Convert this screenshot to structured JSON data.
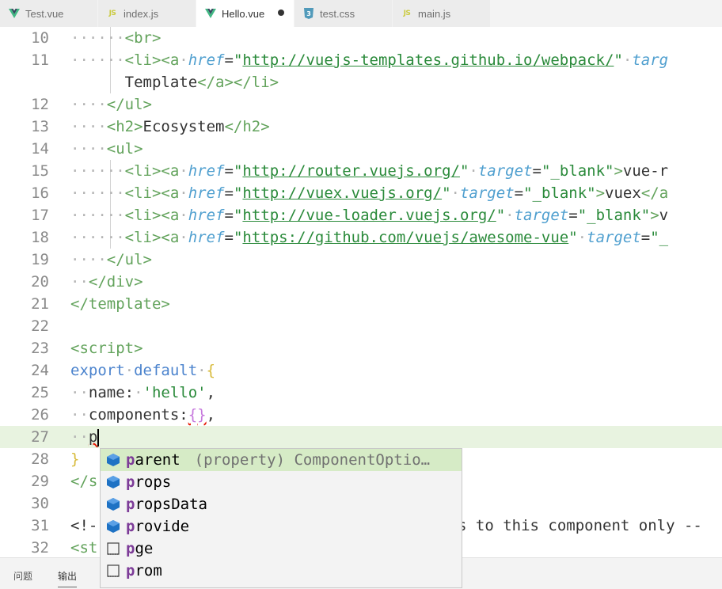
{
  "tabs": [
    {
      "label": "Test.vue",
      "icon": "vue-icon",
      "active": false,
      "dirty": false
    },
    {
      "label": "index.js",
      "icon": "js-icon",
      "active": false,
      "dirty": false
    },
    {
      "label": "Hello.vue",
      "icon": "vue-icon",
      "active": true,
      "dirty": true
    },
    {
      "label": "test.css",
      "icon": "css-icon",
      "active": false,
      "dirty": false
    },
    {
      "label": "main.js",
      "icon": "js-icon",
      "active": false,
      "dirty": false
    }
  ],
  "js_icon_text": "JS",
  "editor": {
    "line_numbers": [
      "10",
      "11",
      "",
      "12",
      "13",
      "14",
      "15",
      "16",
      "17",
      "18",
      "19",
      "20",
      "21",
      "22",
      "23",
      "24",
      "25",
      "26",
      "27",
      "28",
      "29",
      "30",
      "31",
      "32"
    ],
    "code": {
      "l10": "<br>",
      "l11_tag": "<li><a",
      "l11_attr": "href",
      "l11_url": "http://vuejs-templates.github.io/webpack/",
      "l11_attr2": "targ",
      "l11b_text": "Template",
      "l11b_close": "</a></li>",
      "l12": "</ul>",
      "l13_open": "<h2>",
      "l13_text": "Ecosystem",
      "l13_close": "</h2>",
      "l14": "<ul>",
      "l15_url": "http://router.vuejs.org/",
      "l15_tail": "vue-r",
      "l16_url": "http://vuex.vuejs.org/",
      "l16_tail": "vuex",
      "l16_tail2": "</a",
      "l17_url": "http://vue-loader.vuejs.org/",
      "l17_tail": "v",
      "l18_url": "https://github.com/vuejs/awesome-vue",
      "l18_tail": "\"_",
      "target": "target",
      "blank": "\"_blank\"",
      "l19": "</ul>",
      "l20": "</div>",
      "l21": "</template>",
      "l23": "<script>",
      "l24_kw1": "export",
      "l24_kw2": "default",
      "l24_brace": "{",
      "l25_key": "name:",
      "l25_val": "'hello'",
      "l26_key": "components:",
      "l26_val": "{}",
      "l27_typed": "p",
      "l28": "}",
      "l29": "</s",
      "l31_head": "<!-",
      "l31_tail": "s to this component only --",
      "l32": "<st"
    }
  },
  "suggest": [
    {
      "match": "p",
      "rest": "arent",
      "detail": "(property) ComponentOptio…",
      "icon": "property-icon",
      "selected": true
    },
    {
      "match": "p",
      "rest": "rops",
      "detail": "",
      "icon": "property-icon",
      "selected": false
    },
    {
      "match": "p",
      "rest": "ropsData",
      "detail": "",
      "icon": "property-icon",
      "selected": false
    },
    {
      "match": "p",
      "rest": "rovide",
      "detail": "",
      "icon": "property-icon",
      "selected": false
    },
    {
      "match": "p",
      "rest": "ge",
      "detail": "",
      "icon": "word-icon",
      "selected": false
    },
    {
      "match": "p",
      "rest": "rom",
      "detail": "",
      "icon": "word-icon",
      "selected": false
    }
  ],
  "panel": {
    "problems": "问题",
    "output": "输出"
  }
}
